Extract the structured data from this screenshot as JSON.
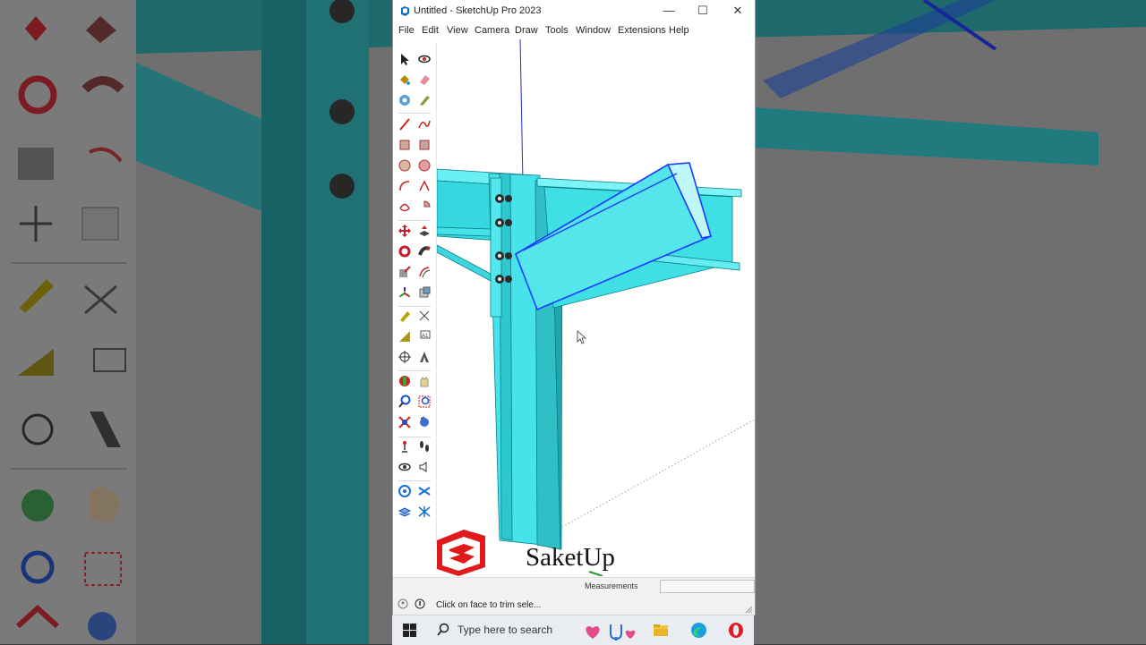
{
  "window": {
    "title": "Untitled - SketchUp Pro 2023",
    "controls": {
      "minimize": "—",
      "maximize": "☐",
      "close": "✕"
    }
  },
  "menu": {
    "items": [
      "File",
      "Edit",
      "View",
      "Camera",
      "Draw",
      "Tools",
      "Window",
      "Extensions",
      "Help"
    ]
  },
  "toolbar": {
    "icons": [
      "select-icon",
      "orbit-icon",
      "paint-bucket-icon",
      "eraser-icon",
      "component-icon",
      "pencil-tag-icon",
      "line-icon",
      "freehand-icon",
      "rectangle-icon",
      "rotated-rectangle-icon",
      "circle-icon",
      "polygon-icon",
      "arc-icon",
      "two-point-arc-icon",
      "three-point-arc-icon",
      "pie-icon",
      "move-icon",
      "push-pull-icon",
      "rotate-icon",
      "follow-me-icon",
      "scale-icon",
      "offset-icon",
      "axes-icon",
      "outer-shell-icon",
      "tape-measure-icon",
      "dimension-icon",
      "protractor-icon",
      "text-icon",
      "axes-cross-icon",
      "3d-text-icon",
      "section-plane-icon",
      "pan-icon",
      "zoom-icon",
      "zoom-window-icon",
      "zoom-extents-icon",
      "previous-view-icon",
      "position-camera-icon",
      "walk-icon",
      "look-around-icon",
      "sound-icon",
      "sandbox-icon",
      "flip-icon",
      "layers-icon",
      "stamp-icon"
    ]
  },
  "viewport": {
    "scene": "steel-beam-connection",
    "logo_text": "SaketUp"
  },
  "statusbar": {
    "measurements_label": "Measurements",
    "measurements_value": "",
    "status_text": "Click on face to trim sele..."
  },
  "taskbar": {
    "search_placeholder": "Type here to search"
  },
  "colors": {
    "steel": "#3fe6ec",
    "steel_dark": "#1ec3cc",
    "selection": "#1a3bff",
    "brand_red": "#e01a1a"
  }
}
